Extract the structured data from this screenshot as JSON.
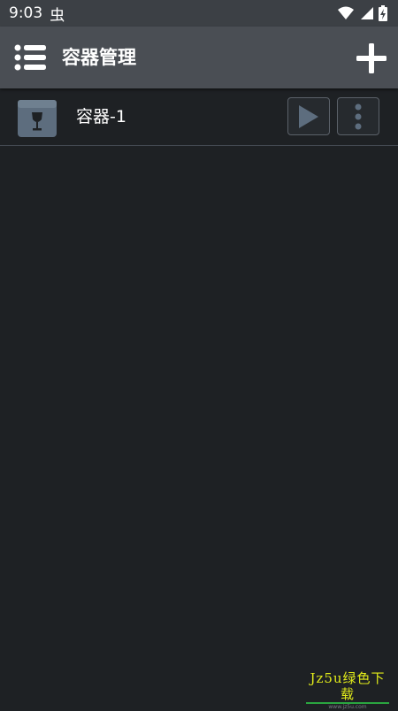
{
  "status_bar": {
    "time": "9:03",
    "notification_glyph": "虫",
    "icons": [
      "wifi-icon",
      "cell-signal-icon",
      "battery-charging-icon"
    ]
  },
  "toolbar": {
    "title": "容器管理",
    "menu_icon": "list-menu-icon",
    "add_icon": "plus-icon"
  },
  "containers": [
    {
      "name": "容器-1",
      "icon": "wine-glass-container-icon"
    }
  ],
  "watermark": {
    "text": "Jz5u绿色下载",
    "subtext": "www.jz5u.com"
  },
  "colors": {
    "background": "#1e2124",
    "toolbar": "#4a4e54",
    "status_bar": "#3c4045",
    "icon_fill": "#5d6d7e",
    "divider": "#444a52",
    "watermark_text": "#e0ea1a",
    "watermark_underline": "#2aa640"
  }
}
